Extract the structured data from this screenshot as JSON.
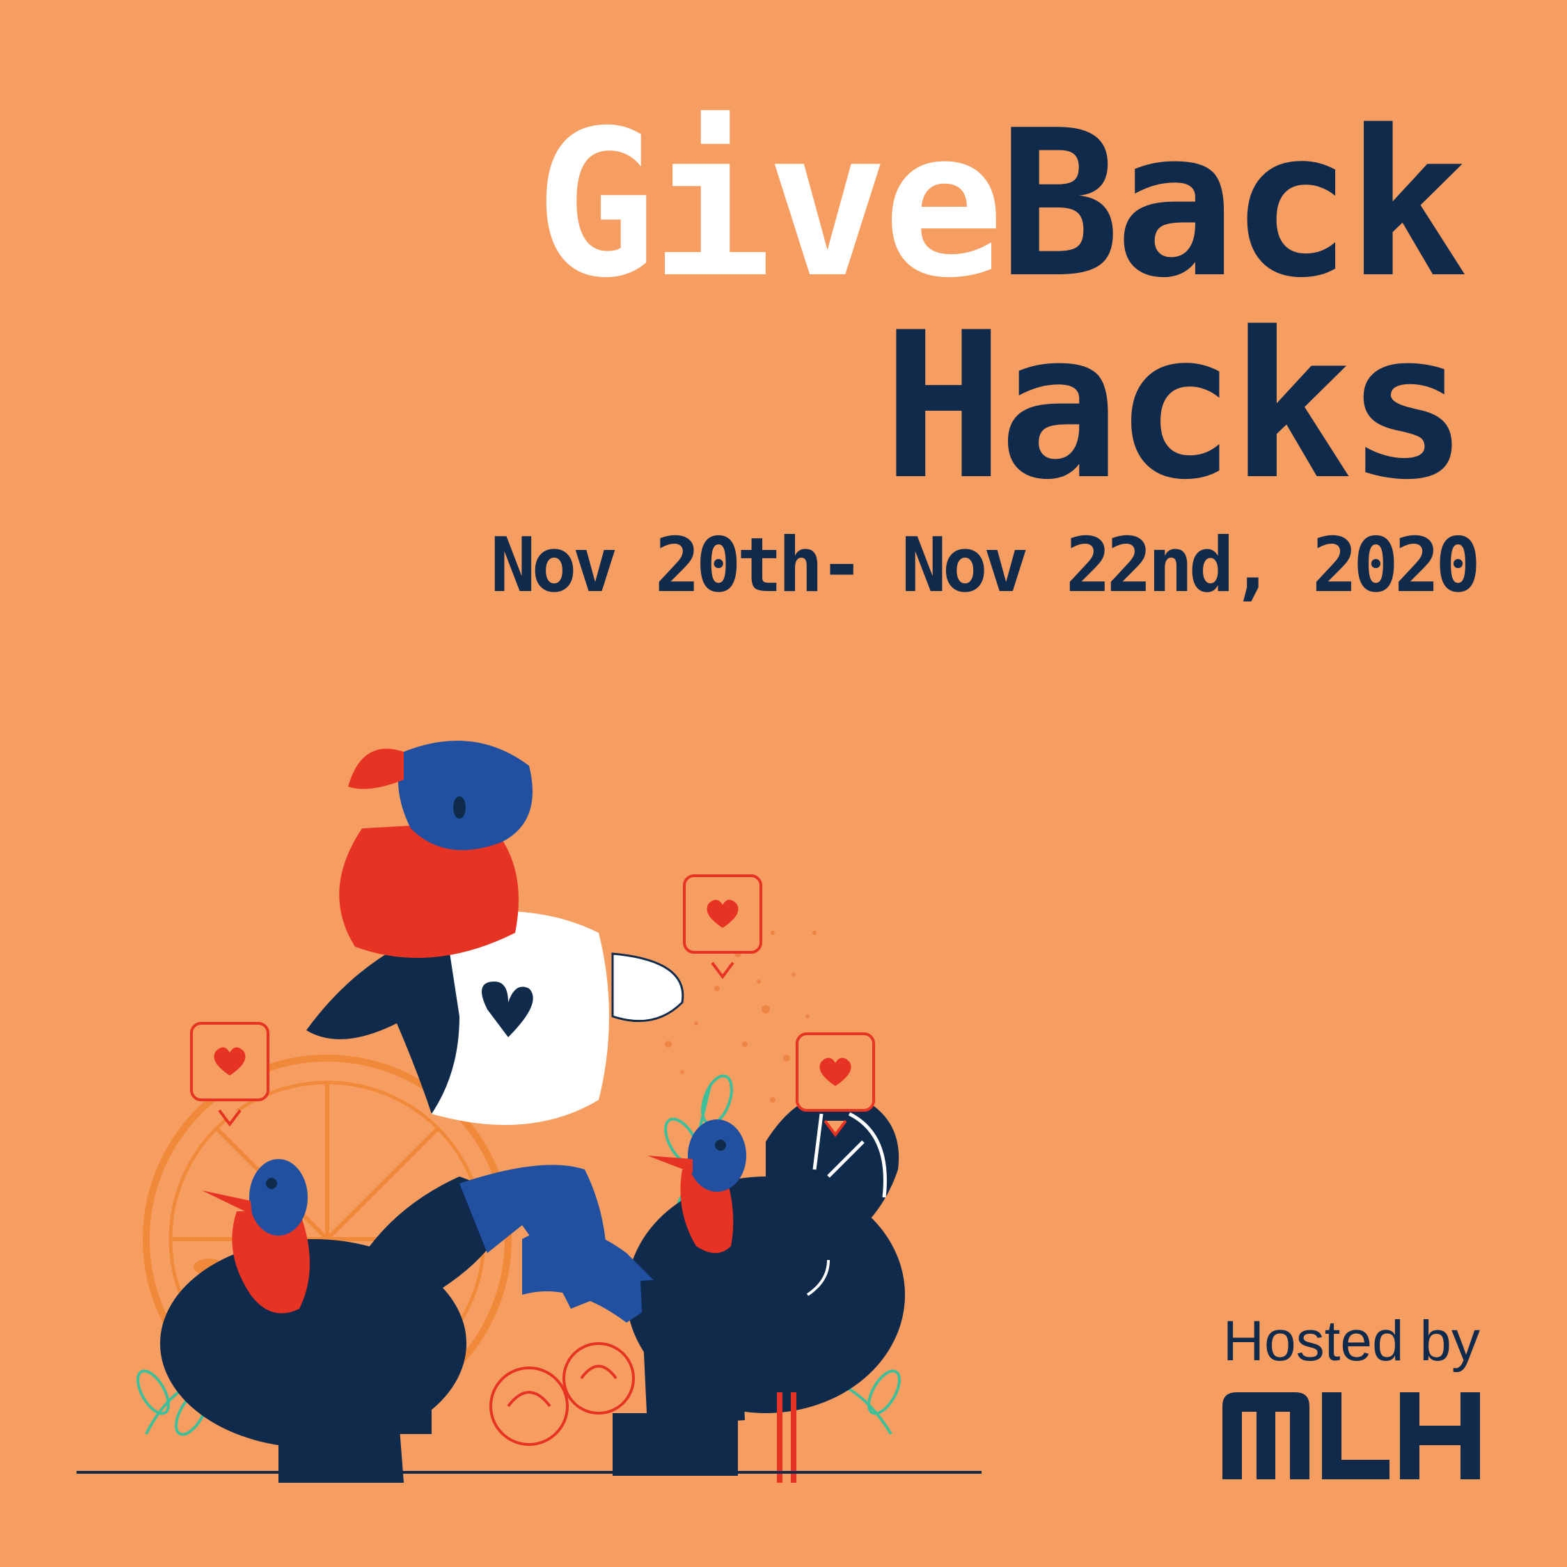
{
  "title": {
    "part1": "Give",
    "part2": "Back",
    "line2": "Hacks"
  },
  "dates": "Nov 20th- Nov 22nd, 2020",
  "hosted_by": "Hosted by",
  "logo_text": "MLH",
  "colors": {
    "background": "#F69E62",
    "navy": "#102A4C",
    "white": "#FFFFFF",
    "red": "#E63323",
    "blue": "#2250A0",
    "orange": "#F08A3A",
    "green": "#3DBF9A"
  },
  "illustration": "person-sitting-with-turkeys-and-heart-likes"
}
